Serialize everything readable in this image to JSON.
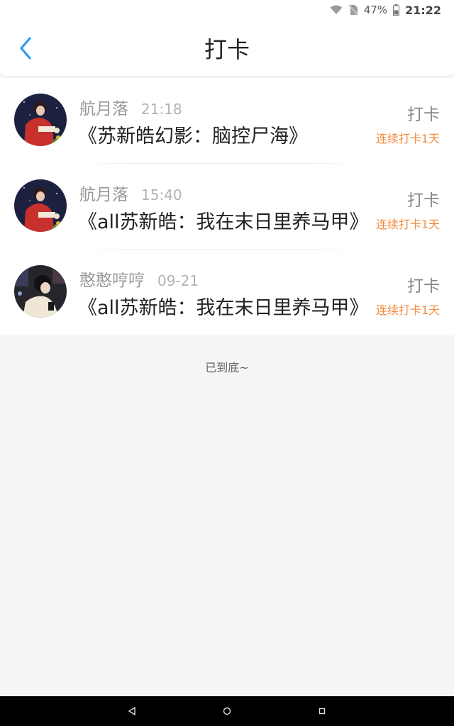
{
  "status_bar": {
    "battery": "47%",
    "time": "21:22",
    "icons": [
      "wifi-icon",
      "no-sim-icon",
      "battery-icon"
    ]
  },
  "header": {
    "title": "打卡",
    "back_icon": "chevron-left-icon"
  },
  "list": {
    "items": [
      {
        "username": "航月落",
        "time": "21:18",
        "book_title": "《苏新皓幻影：脑控尸海》",
        "checkin_label": "打卡",
        "streak": "连续打卡1天",
        "avatar": "avatar-red-outfit"
      },
      {
        "username": "航月落",
        "time": "15:40",
        "book_title": "《all苏新皓：我在末日里养马甲》",
        "checkin_label": "打卡",
        "streak": "连续打卡1天",
        "avatar": "avatar-red-outfit"
      },
      {
        "username": "憨憨哼哼",
        "time": "09-21",
        "book_title": "《all苏新皓：我在末日里养马甲》",
        "checkin_label": "打卡",
        "streak": "连续打卡1天",
        "avatar": "avatar-white-shirt"
      }
    ]
  },
  "footer": {
    "end_text": "已到底~"
  },
  "colors": {
    "accent": "#2f9bf0",
    "streak": "#f58a3c",
    "background": "#f6f4f4"
  },
  "nav_bar": {
    "icons": [
      "back-triangle-icon",
      "home-circle-icon",
      "recents-square-icon"
    ]
  }
}
